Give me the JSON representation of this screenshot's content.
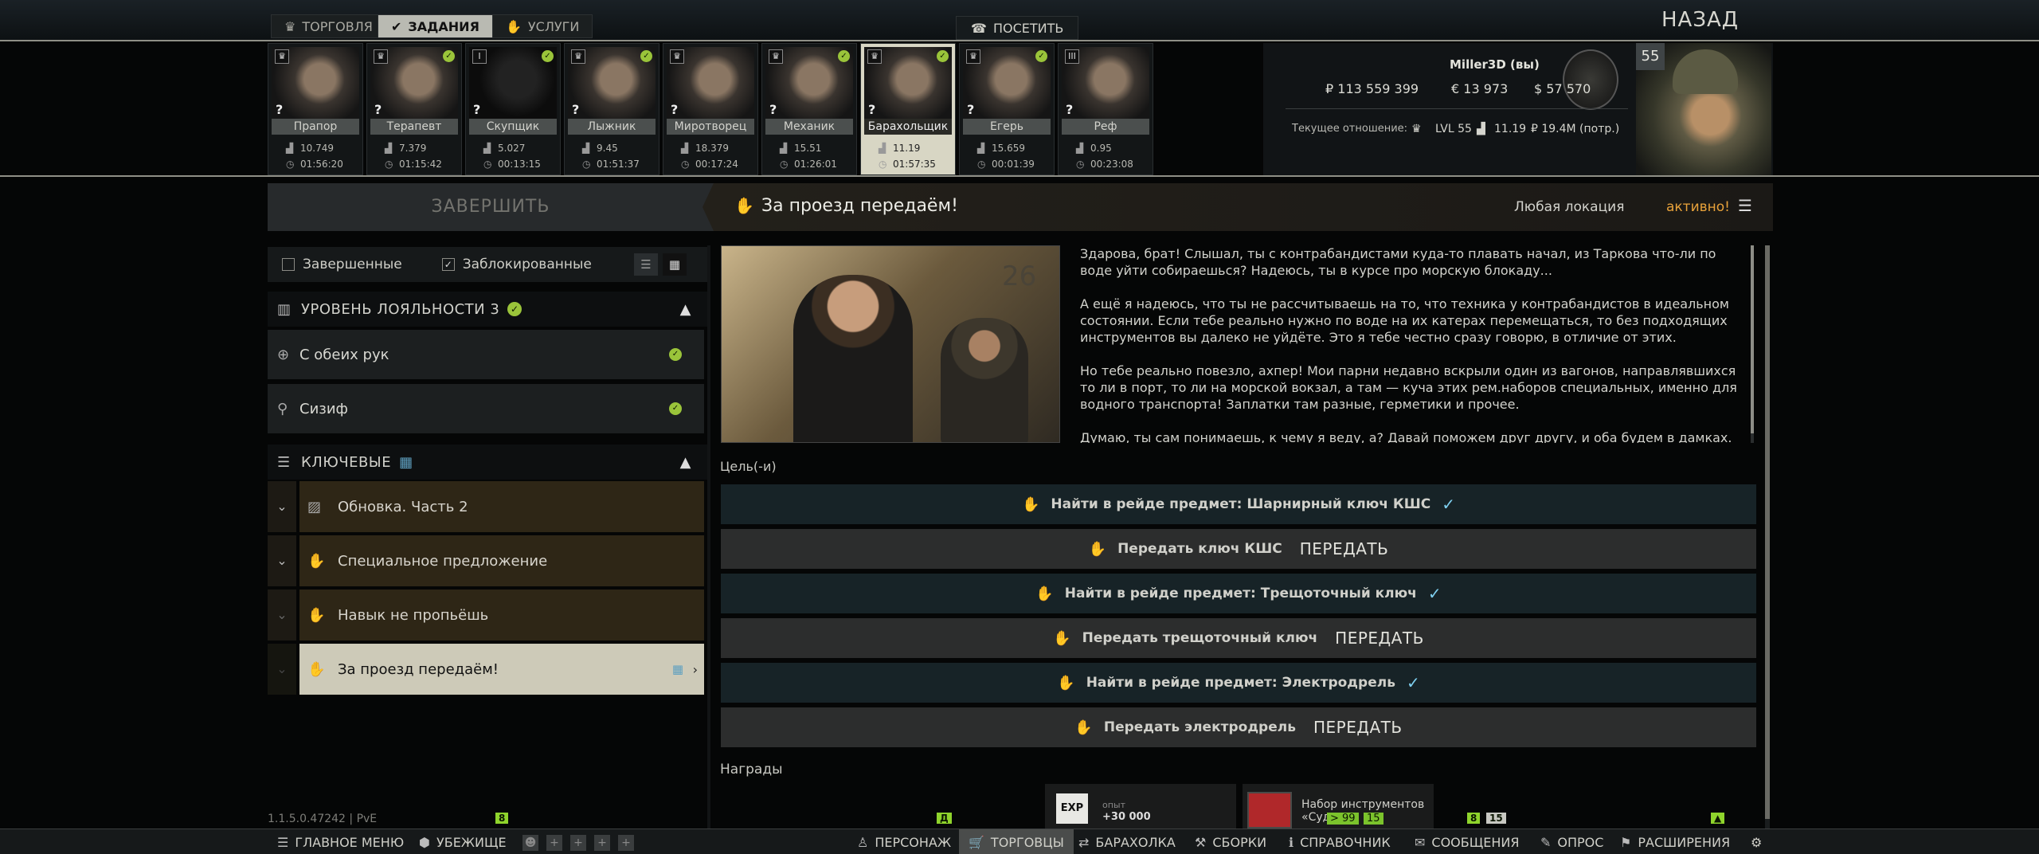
{
  "tabs": {
    "trade": "ТОРГОВЛЯ",
    "tasks": "ЗАДАНИЯ",
    "services": "УСЛУГИ"
  },
  "visit": "ПОСЕТИТЬ",
  "back": "НАЗАД",
  "traders": [
    {
      "name": "Прапор",
      "stat": "10.749",
      "time": "01:56:20"
    },
    {
      "name": "Терапевт",
      "stat": "7.379",
      "time": "01:15:42"
    },
    {
      "name": "Скупщик",
      "stat": "5.027",
      "time": "00:13:15"
    },
    {
      "name": "Лыжник",
      "stat": "9.45",
      "time": "01:51:37"
    },
    {
      "name": "Миротворец",
      "stat": "18.379",
      "time": "00:17:24"
    },
    {
      "name": "Механик",
      "stat": "15.51",
      "time": "01:26:01"
    },
    {
      "name": "Барахольщик",
      "stat": "11.19",
      "time": "01:57:35"
    },
    {
      "name": "Егерь",
      "stat": "15.659",
      "time": "00:01:39"
    },
    {
      "name": "Реф",
      "stat": "0.95",
      "time": "00:23:08"
    }
  ],
  "player": {
    "name": "Miller3D (вы)",
    "roubles": "₽ 113 559 399",
    "euros": "€ 13 973",
    "dollars": "$ 57 570",
    "relation_label": "Текущее отношение:",
    "lvl": "LVL 55",
    "standing": "11.19",
    "spent": "₽ 19.4M (потр.)",
    "level": "55"
  },
  "left": {
    "complete": "ЗАВЕРШИТЬ",
    "completed_filter": "Завершенные",
    "blocked_filter": "Заблокированные",
    "loyalty_header": "УРОВЕНЬ ЛОЯЛЬНОСТИ 3",
    "loyalty_items": [
      "С обеих рук",
      "Сизиф"
    ],
    "key_header": "КЛЮЧЕВЫЕ",
    "quests": [
      "Обновка. Часть 2",
      "Специальное предложение",
      "Навык не пропьёшь",
      "За проезд передаём!"
    ],
    "version": "1.1.5.0.47242 | PvE"
  },
  "quest": {
    "title": "За проезд передаём!",
    "location": "Любая локация",
    "status": "активно!",
    "desc": [
      "Здарова, брат! Слышал, ты с контрабандистами куда-то плавать начал, из Таркова что-ли по воде уйти собираешься? Надеюсь, ты в курсе про морскую блокаду...",
      "А ещё я надеюсь, что ты не рассчитываешь на то, что техника у контрабандистов в идеальном состоянии. Если тебе реально нужно по воде на их катерах перемещаться, то без подходящих инструментов вы далеко не уйдёте. Это я тебе честно сразу говорю, в отличие от этих.",
      "Но тебе реально повезло, ахпер! Мои парни недавно вскрыли один из вагонов, направлявшихся то ли в порт, то ли на морской вокзал, а там — куча этих рем.наборов специальных, именно для водного транспорта! Заплатки там разные, герметики и прочее.",
      "Думаю, ты сам понимаешь, к чему я веду, а? Давай поможем друг другу, и оба будем в дамках."
    ],
    "image_number": "26",
    "objectives_label": "Цель(-и)",
    "objectives": [
      "Найти в рейде предмет: Шарнирный ключ КШС",
      "Передать ключ КШС",
      "Найти в рейде предмет: Трещоточный ключ",
      "Передать трещоточный ключ",
      "Найти в рейде предмет: Электродрель",
      "Передать электродрель"
    ],
    "handover": "ПЕРЕДАТЬ",
    "rewards_label": "Награды",
    "reward_exp_icon": "EXP",
    "reward_exp_label": "опыт",
    "reward_exp_value": "+30 000",
    "reward_item_name": "Набор инструментов «Суд",
    "reward_item_tag1": "> 99",
    "reward_item_tag2": "15"
  },
  "bottom": {
    "main_menu": "ГЛАВНОЕ МЕНЮ",
    "hideout": "УБЕЖИЩЕ",
    "character": "ПЕРСОНАЖ",
    "traders": "ТОРГОВЦЫ",
    "flea": "БАРАХОЛКА",
    "builds": "СБОРКИ",
    "handbook": "СПРАВОЧНИК",
    "messages": "СООБЩЕНИЯ",
    "survey": "ОПРОС",
    "extensions": "РАСШИРЕНИЯ",
    "badge_main": "8",
    "badge_char": "Д",
    "badge_msg": "8",
    "badge_msg2": "15",
    "badge_ext": "▲"
  },
  "colors": {
    "accent_green": "#9ac43a",
    "status_orange": "#e8a23a",
    "check_blue": "#7fd0f0"
  }
}
